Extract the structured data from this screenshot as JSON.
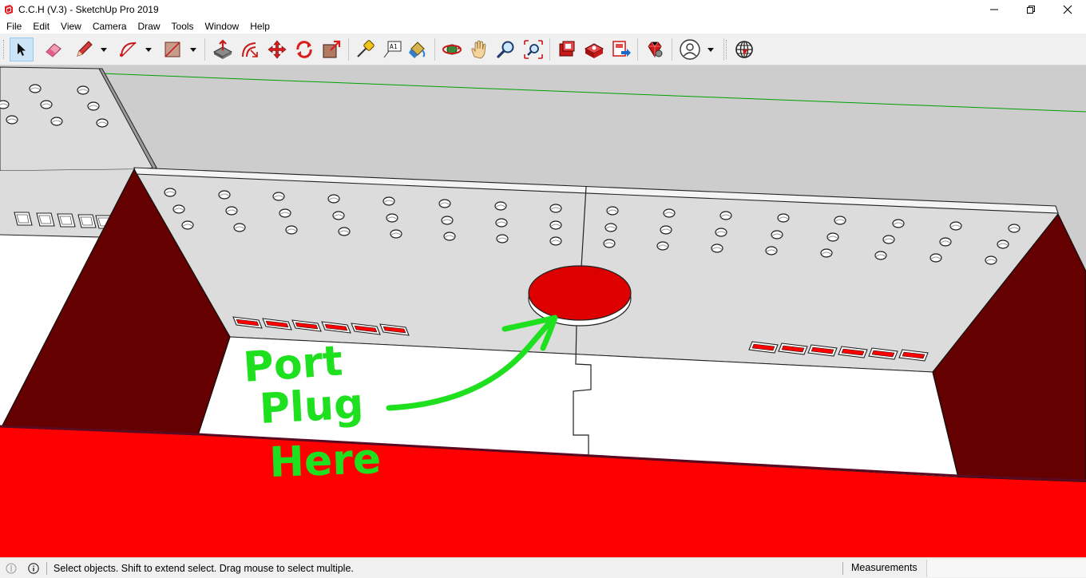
{
  "window": {
    "title": "C.C.H (V.3) - SketchUp Pro 2019"
  },
  "menu": {
    "items": [
      "File",
      "Edit",
      "View",
      "Camera",
      "Draw",
      "Tools",
      "Window",
      "Help"
    ]
  },
  "toolbar": {
    "tools": [
      {
        "name": "select-tool",
        "icon": "arrow-cursor-icon",
        "active": true
      },
      {
        "name": "eraser-tool",
        "icon": "eraser-icon"
      },
      {
        "name": "line-tool",
        "icon": "pencil-icon"
      },
      {
        "name": "arc-tool",
        "icon": "arc-icon"
      },
      {
        "name": "rectangle-tool",
        "icon": "rectangle-icon"
      },
      {
        "name": "push-pull-tool",
        "icon": "push-pull-icon"
      },
      {
        "name": "offset-tool",
        "icon": "offset-icon"
      },
      {
        "name": "move-tool",
        "icon": "move-icon"
      },
      {
        "name": "rotate-tool",
        "icon": "rotate-icon"
      },
      {
        "name": "scale-tool",
        "icon": "scale-icon"
      },
      {
        "name": "tape-measure-tool",
        "icon": "tape-measure-icon"
      },
      {
        "name": "text-tool",
        "icon": "text-icon"
      },
      {
        "name": "paint-bucket-tool",
        "icon": "paint-bucket-icon"
      },
      {
        "name": "orbit-tool",
        "icon": "orbit-icon"
      },
      {
        "name": "pan-tool",
        "icon": "hand-icon"
      },
      {
        "name": "zoom-tool",
        "icon": "magnifier-icon"
      },
      {
        "name": "zoom-extents-tool",
        "icon": "zoom-extents-icon"
      },
      {
        "name": "3d-warehouse",
        "icon": "warehouse-icon"
      },
      {
        "name": "extension-warehouse",
        "icon": "extension-warehouse-icon"
      },
      {
        "name": "layout-send",
        "icon": "send-to-layout-icon"
      },
      {
        "name": "extension-manager",
        "icon": "ruby-gem-icon"
      },
      {
        "name": "account",
        "icon": "user-icon"
      },
      {
        "name": "geo-location",
        "icon": "globe-icon"
      }
    ],
    "text_tool_label": "A1"
  },
  "annotation": {
    "line1": "Port",
    "line2": "Plug",
    "line3": "Here"
  },
  "status": {
    "message": "Select objects. Shift to extend select. Drag mouse to select multiple.",
    "measurements_label": "Measurements",
    "measurements_value": ""
  },
  "colors": {
    "model_red": "#ff0000",
    "dark_red": "#640000",
    "wall_gray": "#dcdcdc",
    "sky_gray": "#cfcfcf",
    "marker_green": "#1fe01f",
    "axis_green": "#00a000"
  }
}
